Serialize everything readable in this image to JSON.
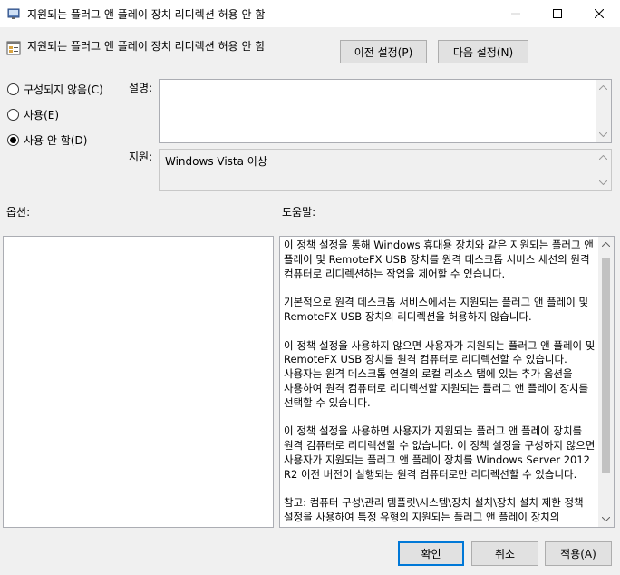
{
  "window": {
    "title": "지원되는 플러그 앤 플레이 장치 리디렉션 허용 안 함"
  },
  "header": {
    "title": "지원되는 플러그 앤 플레이 장치 리디렉션 허용 안 함",
    "prev_button": "이전 설정(P)",
    "next_button": "다음 설정(N)"
  },
  "state": {
    "options": [
      {
        "label": "구성되지 않음(C)",
        "checked": false
      },
      {
        "label": "사용(E)",
        "checked": false
      },
      {
        "label": "사용 안 함(D)",
        "checked": true
      }
    ]
  },
  "fields": {
    "comment_label": "설명:",
    "comment_value": "",
    "supported_label": "지원:",
    "supported_value": "Windows Vista 이상"
  },
  "sections": {
    "options_label": "옵션:",
    "help_label": "도움말:"
  },
  "help": {
    "paragraphs": [
      "이 정책 설정을 통해 Windows 휴대용 장치와 같은 지원되는 플러그 앤 플레이 및 RemoteFX USB 장치를 원격 데스크톱 서비스 세션의 원격 컴퓨터로 리디렉션하는 작업을 제어할 수 있습니다.",
      "기본적으로 원격 데스크톱 서비스에서는 지원되는 플러그 앤 플레이 및 RemoteFX USB 장치의 리디렉션을 허용하지 않습니다.",
      "이 정책 설정을 사용하지 않으면 사용자가 지원되는 플러그 앤 플레이 및 RemoteFX USB 장치를 원격 컴퓨터로 리디렉션할 수 있습니다. 사용자는 원격 데스크톱 연결의 로컬 리소스 탭에 있는 추가 옵션을 사용하여 원격 컴퓨터로 리디렉션할 지원되는 플러그 앤 플레이 장치를 선택할 수 있습니다.",
      "이 정책 설정을 사용하면 사용자가 지원되는 플러그 앤 플레이 장치를 원격 컴퓨터로 리디렉션할 수 없습니다. 이 정책 설정을 구성하지 않으면 사용자가 지원되는 플러그 앤 플레이 장치를 Windows Server 2012 R2 이전 버전이 실행되는 원격 컴퓨터로만 리디렉션할 수 있습니다.",
      "참고: 컴퓨터 구성\\관리 템플릿\\시스템\\장치 설치\\장치 설치 제한 정책 설정을 사용하여 특정 유형의 지원되는 플러그 앤 플레이 장치의 리디렉션을 허용하지 않을 수 있습니다."
    ]
  },
  "footer": {
    "ok_button": "확인",
    "cancel_button": "취소",
    "apply_button": "적용(A)"
  }
}
